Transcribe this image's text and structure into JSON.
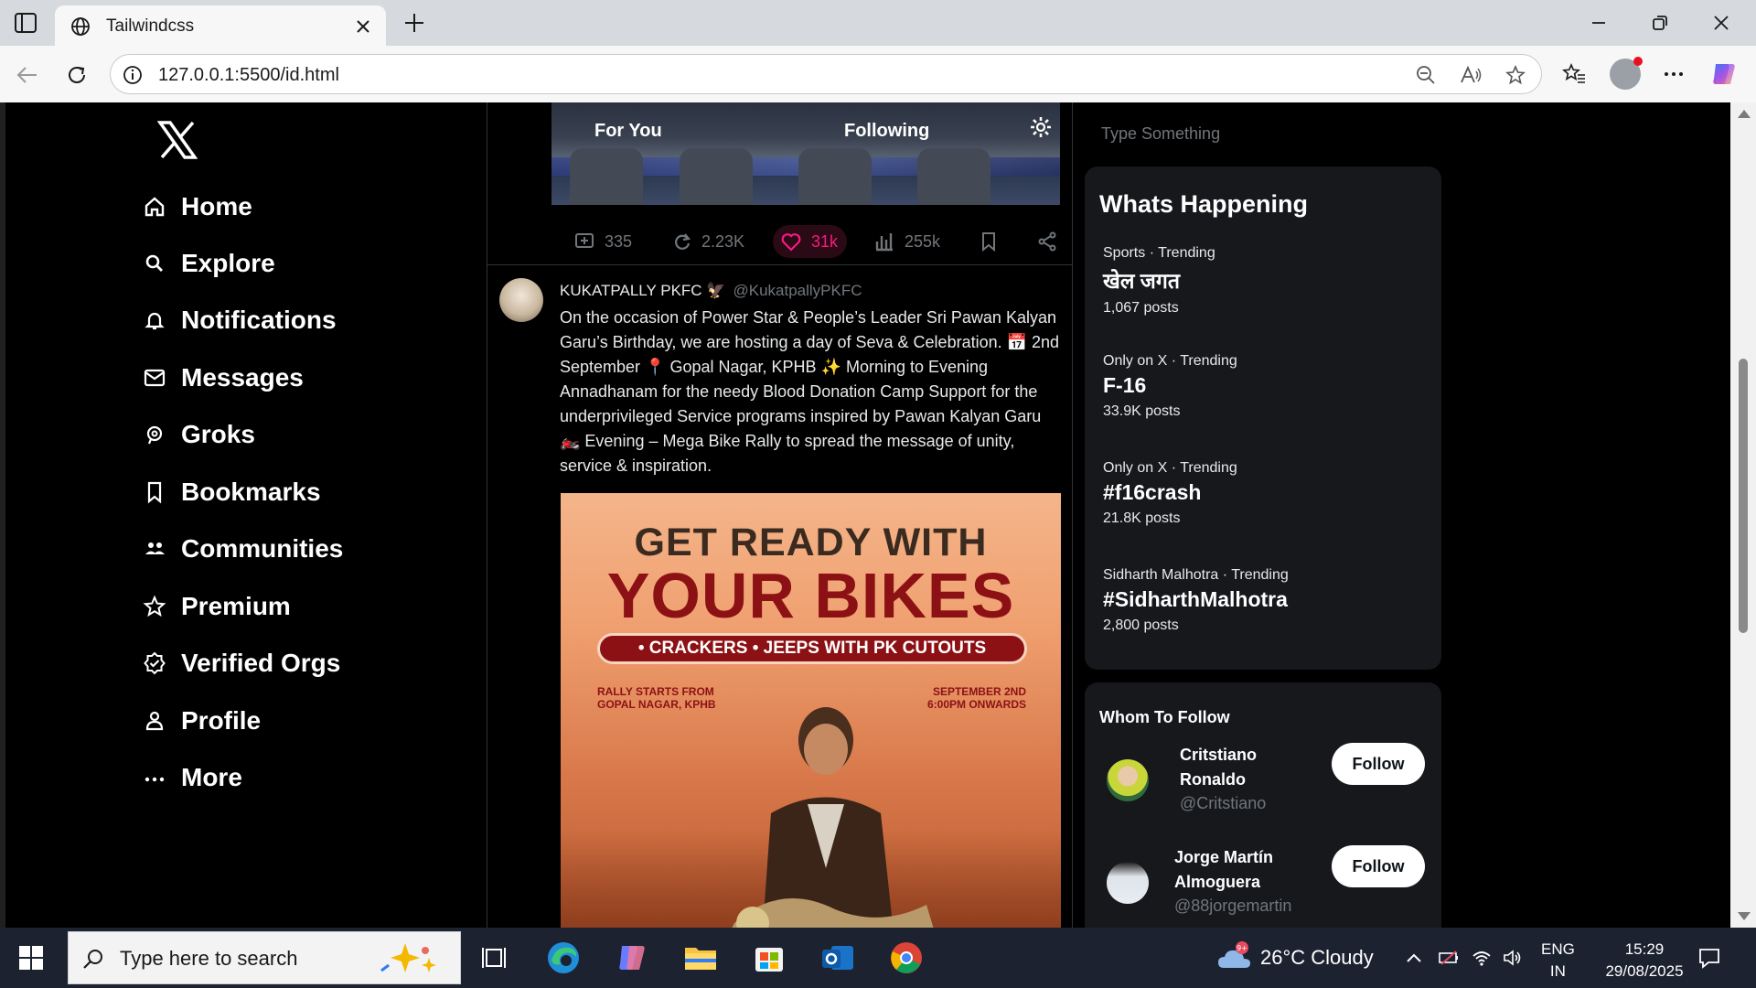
{
  "browser": {
    "tab_title": "Tailwindcss",
    "url": "127.0.0.1:5500/id.html"
  },
  "sidebar": {
    "items": [
      {
        "label": "Home",
        "icon": "home-icon"
      },
      {
        "label": "Explore",
        "icon": "search-icon"
      },
      {
        "label": "Notifications",
        "icon": "bell-icon"
      },
      {
        "label": "Messages",
        "icon": "mail-icon"
      },
      {
        "label": "Groks",
        "icon": "grok-icon"
      },
      {
        "label": "Bookmarks",
        "icon": "bookmark-icon"
      },
      {
        "label": "Communities",
        "icon": "communities-icon"
      },
      {
        "label": "Premium",
        "icon": "star-icon"
      },
      {
        "label": "Verified Orgs",
        "icon": "verified-icon"
      },
      {
        "label": "Profile",
        "icon": "person-icon"
      },
      {
        "label": "More",
        "icon": "more-icon"
      }
    ]
  },
  "feed": {
    "tabs": [
      "For You",
      "Following"
    ],
    "prev_post_actions": {
      "replies": "335",
      "reposts": "2.23K",
      "likes": "31k",
      "views": "255k"
    },
    "tweet": {
      "display_name": "KUKATPALLY PKFC 🦅",
      "handle": "@KukatpallyPKFC",
      "text": "On the occasion of Power Star & People’s Leader Sri Pawan Kalyan Garu’s Birthday, we are hosting a day of Seva & Celebration. 📅 2nd September 📍 Gopal Nagar, KPHB ✨ Morning to Evening Annadhanam for the needy Blood Donation Camp Support for the underprivileged Service programs inspired by Pawan Kalyan Garu 🏍️ Evening – Mega Bike Rally to spread the message of unity, service & inspiration.",
      "poster": {
        "line1": "GET READY WITH",
        "line2": "YOUR BIKES",
        "pill": "• CRACKERS • JEEPS WITH PK CUTOUTS",
        "left_info_1": "RALLY STARTS FROM",
        "left_info_2": "GOPAL NAGAR, KPHB",
        "right_info_1": "SEPTEMBER 2ND",
        "right_info_2": "6:00PM ONWARDS"
      }
    }
  },
  "right": {
    "search_placeholder": "Type Something",
    "whats_happening": {
      "title": "Whats Happening",
      "trends": [
        {
          "meta": "Sports · Trending",
          "name": "खेल जगत",
          "posts": "1,067 posts"
        },
        {
          "meta": "Only on X · Trending",
          "name": "F-16",
          "posts": "33.9K posts"
        },
        {
          "meta": "Only on X · Trending",
          "name": "#f16crash",
          "posts": "21.8K posts"
        },
        {
          "meta": "Sidharth Malhotra · Trending",
          "name": "#SidharthMalhotra",
          "posts": "2,800 posts"
        }
      ]
    },
    "who_to_follow": {
      "title": "Whom To Follow",
      "users": [
        {
          "name": "Critstiano Ronaldo",
          "handle": "@Critstiano",
          "button": "Follow"
        },
        {
          "name": "Jorge Martín Almoguera",
          "handle": "@88jorgemartin",
          "button": "Follow"
        }
      ]
    }
  },
  "taskbar": {
    "search_placeholder": "Type here to search",
    "weather": "26°C  Cloudy",
    "weather_badge": "9+",
    "lang_1": "ENG",
    "lang_2": "IN",
    "time": "15:29",
    "date": "29/08/2025"
  },
  "colors": {
    "accent_blue": "#1d9bf0",
    "like_pink": "#f91880",
    "muted": "#71767b",
    "card_bg": "#16181c"
  }
}
